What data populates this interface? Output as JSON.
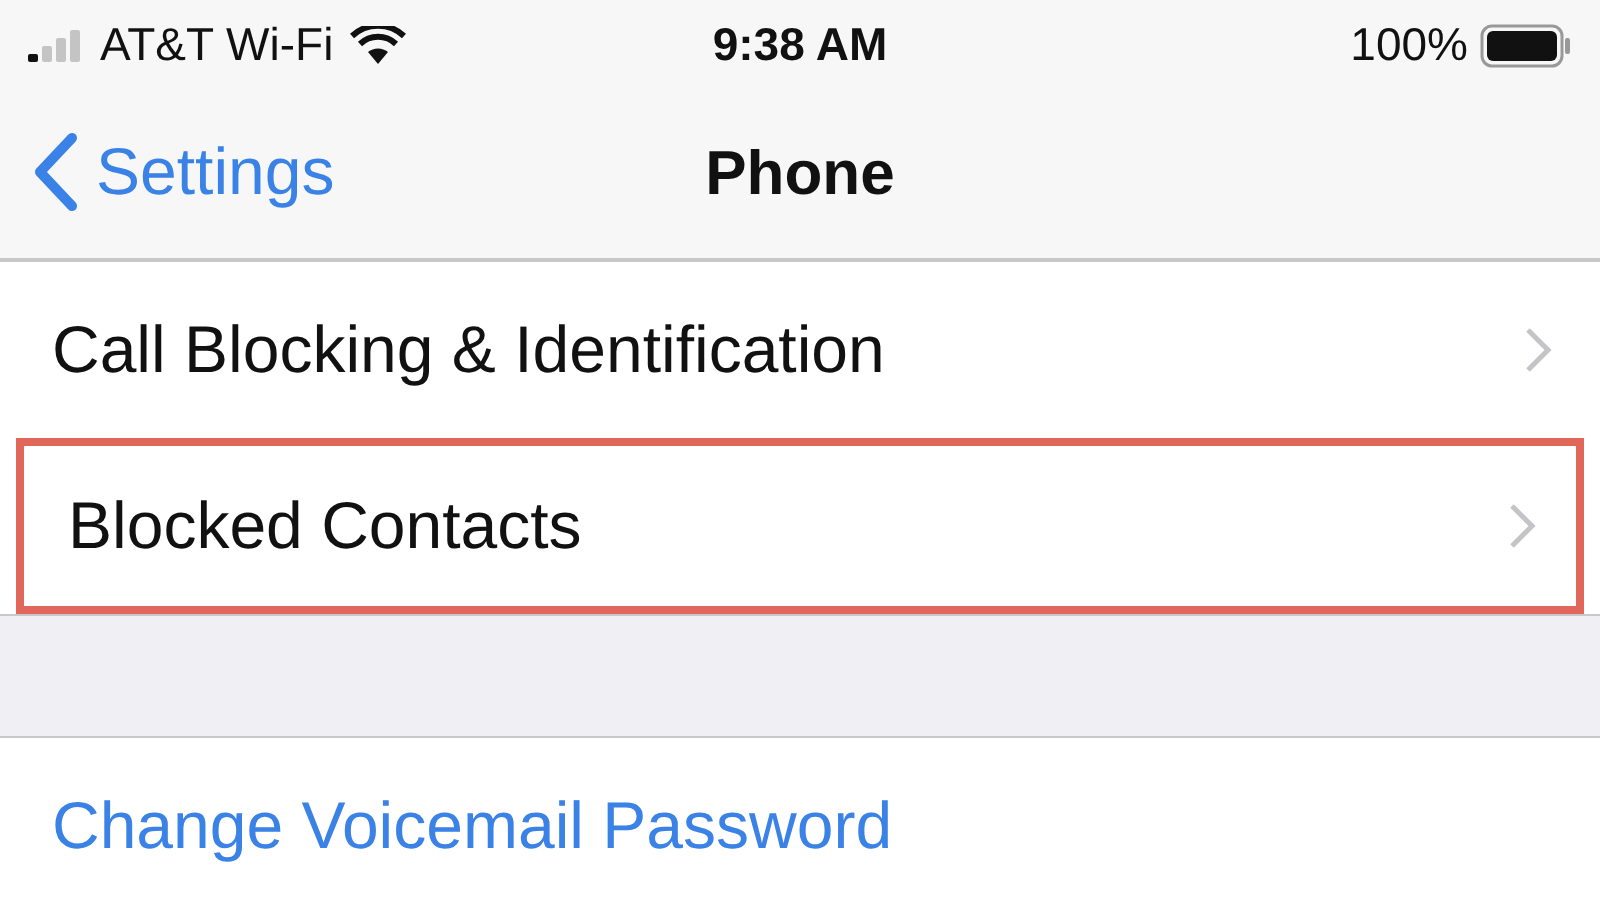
{
  "status_bar": {
    "carrier": "AT&T Wi-Fi",
    "time": "9:38 AM",
    "battery": "100%"
  },
  "nav": {
    "back": "Settings",
    "title": "Phone"
  },
  "groups": [
    {
      "rows": [
        {
          "label": "Call Blocking & Identification",
          "kind": "disclosure",
          "highlighted": false
        },
        {
          "label": "Blocked Contacts",
          "kind": "disclosure",
          "highlighted": true
        }
      ]
    },
    {
      "rows": [
        {
          "label": "Change Voicemail Password",
          "kind": "action",
          "highlighted": false
        }
      ]
    }
  ]
}
